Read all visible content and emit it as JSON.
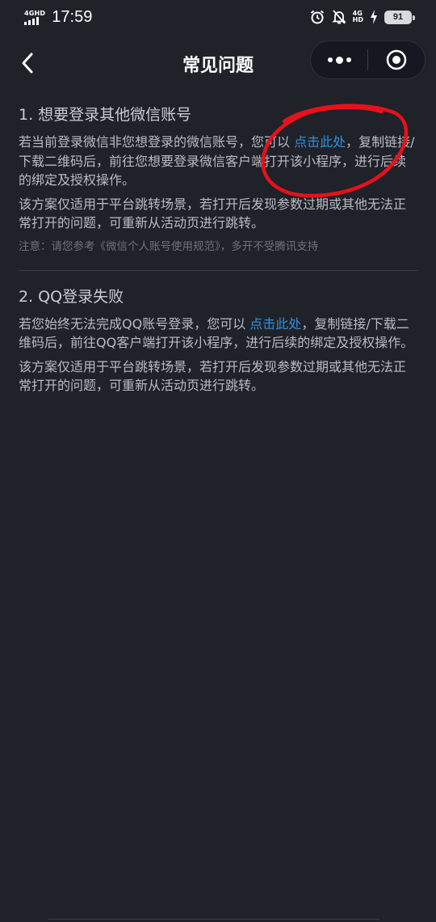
{
  "status_bar": {
    "network_label": "4GHD",
    "time": "17:59",
    "net2_top": "4G",
    "net2_bottom": "HD",
    "battery_level": "91"
  },
  "nav": {
    "title": "常见问题"
  },
  "faq": [
    {
      "title": "1. 想要登录其他微信账号",
      "p1_before": "若当前登录微信非您想登录的微信账号，您可以",
      "p1_link": "点击此处",
      "p1_after": "，复制链接/下载二维码后，前往您想要登录微信客户端打开该小程序，进行后续的绑定及授权操作。",
      "p2": "该方案仅适用于平台跳转场景，若打开后发现参数过期或其他无法正常打开的问题，可重新从活动页进行跳转。",
      "note": "注意：请您参考《微信个人账号使用规范》，多开不受腾讯支持"
    },
    {
      "title": "2. QQ登录失败",
      "p1_before": "若您始终无法完成QQ账号登录，您可以",
      "p1_link": "点击此处",
      "p1_after": "，复制链接/下载二维码后，前往QQ客户端打开该小程序，进行后续的绑定及授权操作。",
      "p2": "该方案仅适用于平台跳转场景，若打开后发现参数过期或其他无法正常打开的问题，可重新从活动页进行跳转。"
    }
  ],
  "colors": {
    "background": "#1f2229",
    "link": "#2f8fe0",
    "annotation": "#e8101a"
  },
  "icons": {
    "back": "chevron-left-icon",
    "more": "more-dots-icon",
    "close": "target-circle-icon"
  }
}
